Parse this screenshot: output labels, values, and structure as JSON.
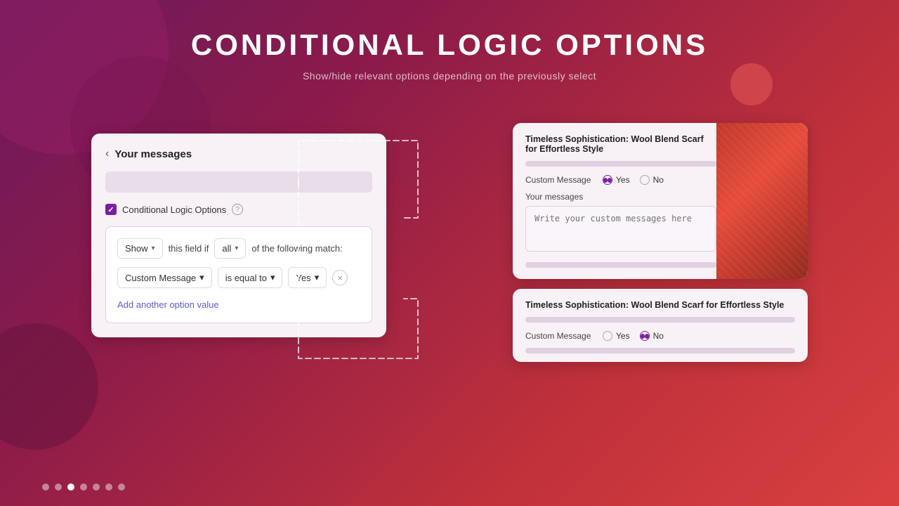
{
  "header": {
    "title": "CONDITIONAL LOGIC OPTIONS",
    "subtitle": "Show/hide relevant options depending on the previously select"
  },
  "left_panel": {
    "card_title": "Your messages",
    "checkbox_label": "Conditional Logic Options",
    "logic": {
      "show_label": "Show",
      "this_field_label": "this field if",
      "all_label": "all",
      "following_match_label": "of the following match:",
      "condition_field": "Custom Message",
      "condition_operator": "is equal to",
      "condition_value": "Yes",
      "add_option_label": "Add another option value"
    }
  },
  "right_panel": {
    "top_card": {
      "product_title": "Timeless Sophistication: Wool Blend Scarf for Effortless Style",
      "custom_message_label": "Custom Message",
      "yes_label": "Yes",
      "no_label": "No",
      "yes_selected": true,
      "your_messages_label": "Your messages",
      "textarea_placeholder": "Write your custom messages here"
    },
    "bottom_card": {
      "product_title": "Timeless Sophistication: Wool Blend Scarf for Effortless Style",
      "custom_message_label": "Custom Message",
      "yes_label": "Yes",
      "no_label": "No",
      "no_selected": true
    }
  },
  "dots": [
    {
      "active": false
    },
    {
      "active": false
    },
    {
      "active": true
    },
    {
      "active": false
    },
    {
      "active": false
    },
    {
      "active": false
    },
    {
      "active": false
    }
  ],
  "colors": {
    "accent": "#7b1fa2",
    "link": "#5c5ccc"
  }
}
